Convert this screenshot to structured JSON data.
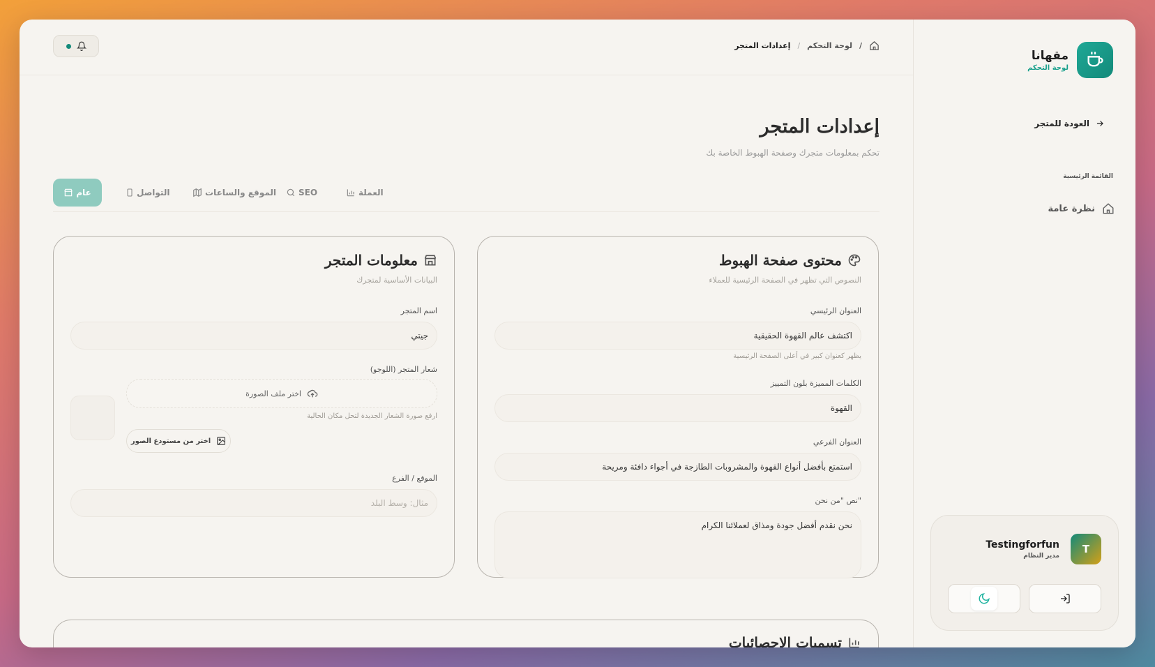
{
  "brand": {
    "name": "مقهانا",
    "subtitle": "لوحة التحكم"
  },
  "sidebar": {
    "back_label": "العودة للمتجر",
    "section_label": "القائمة الرئيسية",
    "items": [
      {
        "label": "نظرة عامة",
        "icon": "home-icon"
      }
    ]
  },
  "user": {
    "initial": "T",
    "name": "Testingforfun",
    "role": "مدير النظام"
  },
  "breadcrumb": {
    "home_label": "لوحة التحكم",
    "separator_1": "/",
    "separator_2": "/",
    "current": "إعدادات المتجر"
  },
  "page": {
    "title": "إعدادات المتجر",
    "subtitle": "تحكم بمعلومات متجرك وصفحة الهبوط الخاصة بك"
  },
  "tabs": [
    {
      "label": "عام",
      "icon": "store-icon",
      "active": true
    },
    {
      "label": "التواصل",
      "icon": "phone-icon",
      "active": false
    },
    {
      "label": "الموقع والساعات",
      "icon": "map-icon",
      "active": false
    },
    {
      "label": "SEO",
      "icon": "search-icon",
      "active": false
    },
    {
      "label": "العملة",
      "icon": "chart-icon",
      "active": false
    }
  ],
  "store_info": {
    "title": "معلومات المتجر",
    "subtitle": "البيانات الأساسية لمتجرك",
    "name_label": "اسم المتجر",
    "name_value": "جيتي",
    "logo_label": "شعار المتجر (اللوجو)",
    "upload_label": "اختر ملف الصورة",
    "upload_hint": "ارفع صورة الشعار الجديدة لتحل مكان الحالية",
    "gallery_label": "اختر من مستودع الصور",
    "location_label": "الموقع / الفرع",
    "location_placeholder": "مثال: وسط البلد"
  },
  "landing": {
    "title": "محتوى صفحة الهبوط",
    "subtitle": "النصوص التي تظهر في الصفحة الرئيسية للعملاء",
    "headline_label": "العنوان الرئيسي",
    "headline_value": "اكتشف عالم القهوة الحقيقية",
    "headline_hint": "يظهر كعنوان كبير في أعلى الصفحة الرئيسية",
    "highlight_label": "الكلمات المميزة بلون التمييز",
    "highlight_value": "القهوة",
    "subheadline_label": "العنوان الفرعي",
    "subheadline_value": "استمتع بأفضل أنواع القهوة والمشروبات الطازجة في أجواء دافئة ومريحة",
    "about_label": "نص \"من نحن\"",
    "about_value": "نحن نقدم أفضل جودة ومذاق لعملائنا الكرام"
  },
  "stats_card": {
    "title": "تسميات الإحصائيات"
  },
  "colors": {
    "accent": "#138a7a",
    "tab_active": "#8fcbbf"
  }
}
